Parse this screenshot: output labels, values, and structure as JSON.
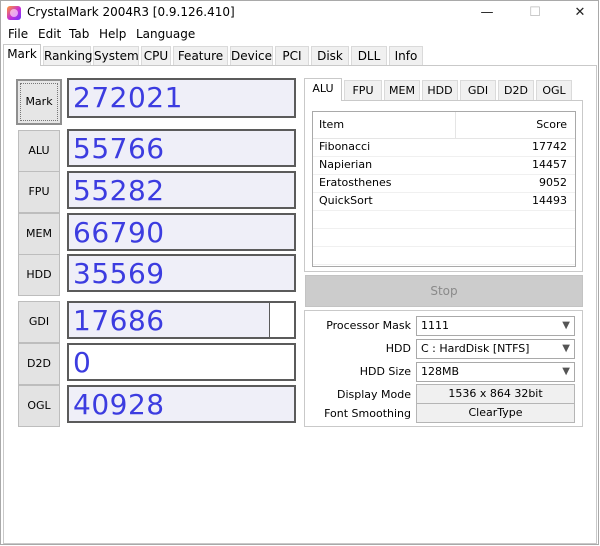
{
  "window": {
    "title": "CrystalMark 2004R3 [0.9.126.410]",
    "minimize": "—",
    "maximize": "☐",
    "close": "✕"
  },
  "menu": [
    "File",
    "Edit",
    "Tab",
    "Help",
    "Language"
  ],
  "tabs": [
    "Mark",
    "Ranking",
    "System",
    "CPU",
    "Feature",
    "Device",
    "PCI",
    "Disk",
    "DLL",
    "Info"
  ],
  "active_tab": "Mark",
  "scores": {
    "mark": {
      "label": "Mark",
      "value": "272021"
    },
    "alu": {
      "label": "ALU",
      "value": "55766"
    },
    "fpu": {
      "label": "FPU",
      "value": "55282"
    },
    "mem": {
      "label": "MEM",
      "value": "66790"
    },
    "hdd": {
      "label": "HDD",
      "value": "35569"
    },
    "gdi": {
      "label": "GDI",
      "value": "17686"
    },
    "d2d": {
      "label": "D2D",
      "value": "0"
    },
    "ogl": {
      "label": "OGL",
      "value": "40928"
    }
  },
  "subtabs": [
    "ALU",
    "FPU",
    "MEM",
    "HDD",
    "GDI",
    "D2D",
    "OGL"
  ],
  "active_subtab": "ALU",
  "list": {
    "headers": [
      "Item",
      "Score"
    ],
    "rows": [
      {
        "item": "Fibonacci",
        "score": "17742"
      },
      {
        "item": "Napierian",
        "score": "14457"
      },
      {
        "item": "Eratosthenes",
        "score": "9052"
      },
      {
        "item": "QuickSort",
        "score": "14493"
      }
    ]
  },
  "stop_label": "Stop",
  "settings": {
    "processor_mask": {
      "label": "Processor Mask",
      "value": "1111"
    },
    "hdd": {
      "label": "HDD",
      "value": "C : HardDisk [NTFS]"
    },
    "hdd_size": {
      "label": "HDD Size",
      "value": "128MB"
    },
    "display_mode": {
      "label": "Display Mode",
      "value": "1536 x 864 32bit"
    },
    "font_smoothing": {
      "label": "Font Smoothing",
      "value": "ClearType"
    }
  },
  "icons": {
    "app": "crystalmark-app-icon",
    "dropdown": "chevron-down-icon"
  }
}
